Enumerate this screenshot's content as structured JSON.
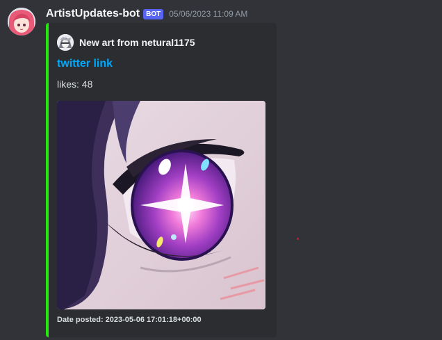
{
  "message": {
    "username": "ArtistUpdates-bot",
    "bot_tag": "BOT",
    "timestamp": "05/06/2023 11:09 AM",
    "avatar_icon": "anime-avatar-icon"
  },
  "embed": {
    "accent_color": "#23ea0c",
    "author": {
      "name": "New art from netural1175",
      "icon": "author-avatar-icon"
    },
    "title": "twitter link",
    "description": "likes: 48",
    "image": "anime-eye-artwork",
    "footer": "Date posted: 2023-05-06 17:01:18+00:00"
  },
  "colors": {
    "background": "#313338",
    "embed_background": "#2b2d31",
    "link": "#00a8fc",
    "bot_tag": "#5865f2"
  }
}
